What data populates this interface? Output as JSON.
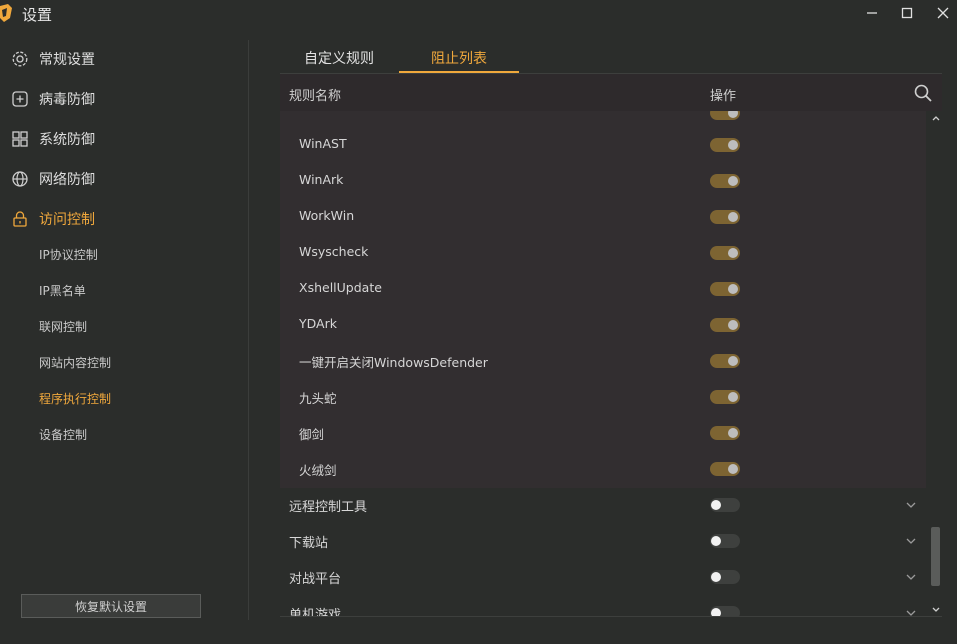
{
  "window": {
    "title": "设置",
    "accent": "#f0a83c"
  },
  "sidebar": {
    "items": [
      {
        "label": "常规设置",
        "icon": "gear-icon"
      },
      {
        "label": "病毒防御",
        "icon": "plus-box-icon"
      },
      {
        "label": "系统防御",
        "icon": "grid-icon"
      },
      {
        "label": "网络防御",
        "icon": "globe-icon"
      },
      {
        "label": "访问控制",
        "icon": "lock-icon",
        "active": true
      }
    ],
    "subitems": [
      {
        "label": "IP协议控制"
      },
      {
        "label": "IP黑名单"
      },
      {
        "label": "联网控制"
      },
      {
        "label": "网站内容控制"
      },
      {
        "label": "程序执行控制",
        "active": true
      },
      {
        "label": "设备控制"
      }
    ],
    "reset_label": "恢复默认设置"
  },
  "tabs": [
    {
      "label": "自定义规则"
    },
    {
      "label": "阻止列表",
      "active": true
    }
  ],
  "table": {
    "col_name": "规则名称",
    "col_action": "操作"
  },
  "rules": [
    {
      "name": "WinAST",
      "enabled": true
    },
    {
      "name": "WinArk",
      "enabled": true
    },
    {
      "name": "WorkWin",
      "enabled": true
    },
    {
      "name": "Wsyscheck",
      "enabled": true
    },
    {
      "name": "XshellUpdate",
      "enabled": true
    },
    {
      "name": "YDArk",
      "enabled": true
    },
    {
      "name": "一键开启关闭WindowsDefender",
      "enabled": true
    },
    {
      "name": "九头蛇",
      "enabled": true
    },
    {
      "name": "御剑",
      "enabled": true
    },
    {
      "name": "火绒剑",
      "enabled": true
    }
  ],
  "categories": [
    {
      "name": "远程控制工具",
      "enabled": false
    },
    {
      "name": "下载站",
      "enabled": false
    },
    {
      "name": "对战平台",
      "enabled": false
    },
    {
      "name": "单机游戏",
      "enabled": false
    }
  ]
}
